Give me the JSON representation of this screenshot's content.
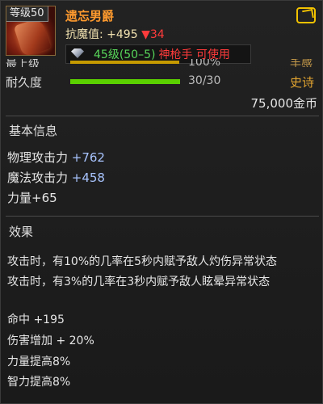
{
  "item": {
    "level_badge": "等级50",
    "name": "遗忘男爵",
    "resist_label": "抗魔值: ",
    "resist_plus": "+495 ",
    "resist_down": "▼34",
    "job_level": "45级(50–5)",
    "job_class": "神枪手 可使用",
    "peek_label": "最上级",
    "peek_value": "100%",
    "peek_right": "手感",
    "durability_label": "耐久度",
    "durability_value": "30/30",
    "durability_fraction": 1.0,
    "rarity": "史诗",
    "price": "75,000金币"
  },
  "basic": {
    "title": "基本信息",
    "stats": [
      {
        "label": "物理攻击力 ",
        "value": "+762"
      },
      {
        "label": "魔法攻击力 ",
        "value": "+458"
      },
      {
        "label": "力量",
        "value": "+65"
      }
    ]
  },
  "effects": {
    "title": "效果",
    "lines": [
      "攻击时，有10%的几率在5秒内赋予敌人灼伤异常状态",
      "攻击时，有3%的几率在3秒内赋予敌人眩晕异常状态"
    ],
    "bonuses": [
      "命中 +195",
      "伤害增加 + 20%",
      "力量提高8%",
      "智力提高8%"
    ]
  },
  "colors": {
    "name": "#ff9a2e",
    "stat_value": "#a8c4ff",
    "job_level": "#58d65a",
    "job_class": "#ff3b3b",
    "rarity": "#e2a430"
  },
  "icons": {
    "item": "gauntlet-icon",
    "share": "share-icon",
    "job": "diamond-icon"
  }
}
